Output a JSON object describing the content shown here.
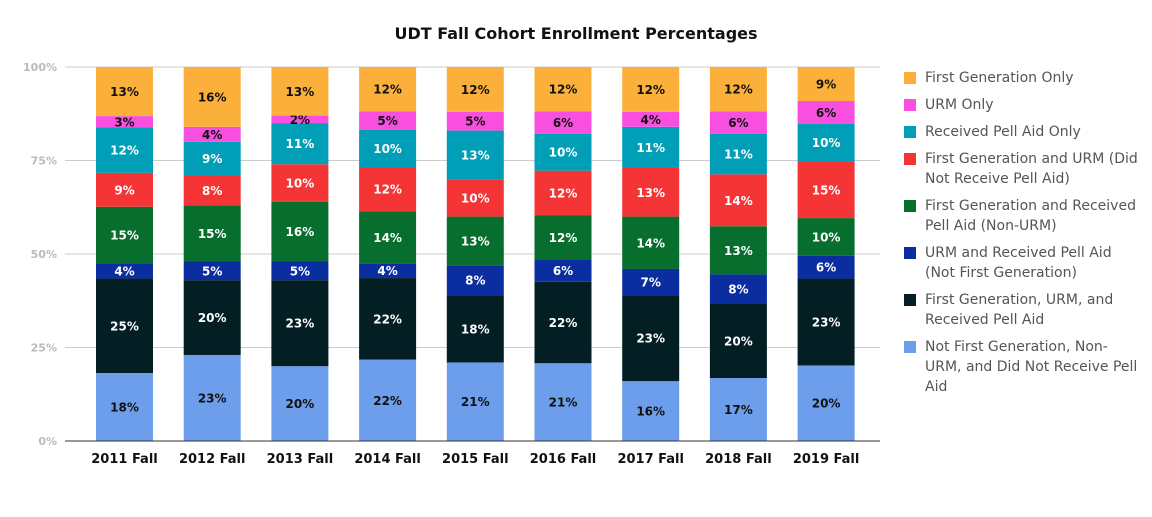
{
  "chart_data": {
    "type": "bar",
    "stacked": true,
    "percent_stacked": true,
    "title": "UDT Fall Cohort Enrollment Percentages",
    "xlabel": "",
    "ylabel": "",
    "ylim": [
      0,
      100
    ],
    "y_ticks": [
      "0%",
      "25%",
      "50%",
      "75%",
      "100%"
    ],
    "y_tick_values": [
      0,
      25,
      50,
      75,
      100
    ],
    "grid": true,
    "legend_position": "right",
    "categories": [
      "2011 Fall",
      "2012 Fall",
      "2013 Fall",
      "2014 Fall",
      "2015 Fall",
      "2016 Fall",
      "2017 Fall",
      "2018 Fall",
      "2019 Fall"
    ],
    "series": [
      {
        "name": "Not First Generation, Non-URM, and Did Not Receive Pell Aid",
        "color": "#6d9eeb",
        "label_color": "#111111",
        "values": [
          18,
          23,
          20,
          22,
          21,
          21,
          16,
          17,
          20
        ]
      },
      {
        "name": "First Generation, URM, and Received Pell Aid",
        "color": "#031f24",
        "label_color": "#ffffff",
        "values": [
          25,
          20,
          23,
          22,
          18,
          22,
          23,
          20,
          23
        ]
      },
      {
        "name": "URM and Received Pell Aid (Not First Generation)",
        "color": "#0a2ea0",
        "label_color": "#ffffff",
        "values": [
          4,
          5,
          5,
          4,
          8,
          6,
          7,
          8,
          6
        ]
      },
      {
        "name": "First Generation and Received Pell Aid (Non-URM)",
        "color": "#076e2e",
        "label_color": "#ffffff",
        "values": [
          15,
          15,
          16,
          14,
          13,
          12,
          14,
          13,
          10
        ]
      },
      {
        "name": "First Generation and URM (Did Not Receive Pell Aid)",
        "color": "#f53535",
        "label_color": "#ffffff",
        "values": [
          9,
          8,
          10,
          12,
          10,
          12,
          13,
          14,
          15
        ]
      },
      {
        "name": "Received Pell Aid Only",
        "color": "#009fb7",
        "label_color": "#ffffff",
        "values": [
          12,
          9,
          11,
          10,
          13,
          10,
          11,
          11,
          10
        ]
      },
      {
        "name": "URM Only",
        "color": "#f94fe0",
        "label_color": "#111111",
        "values": [
          3,
          4,
          2,
          5,
          5,
          6,
          4,
          6,
          6
        ]
      },
      {
        "name": "First Generation Only",
        "color": "#fbb03b",
        "label_color": "#111111",
        "values": [
          13,
          16,
          13,
          12,
          12,
          12,
          12,
          12,
          9
        ]
      }
    ],
    "legend": [
      {
        "label": "First Generation Only",
        "color": "#fbb03b"
      },
      {
        "label": "URM Only",
        "color": "#f94fe0"
      },
      {
        "label": "Received Pell Aid Only",
        "color": "#009fb7"
      },
      {
        "label": "First Generation and URM (Did Not Receive Pell Aid)",
        "color": "#f53535"
      },
      {
        "label": "First Generation and Received Pell Aid (Non-URM)",
        "color": "#076e2e"
      },
      {
        "label": "URM and Received Pell Aid (Not First Generation)",
        "color": "#0a2ea0"
      },
      {
        "label": "First Generation, URM, and Received Pell Aid",
        "color": "#031f24"
      },
      {
        "label": "Not First Generation, Non-URM, and Did Not Receive Pell Aid",
        "color": "#6d9eeb"
      }
    ],
    "data_label_suffix": "%"
  }
}
